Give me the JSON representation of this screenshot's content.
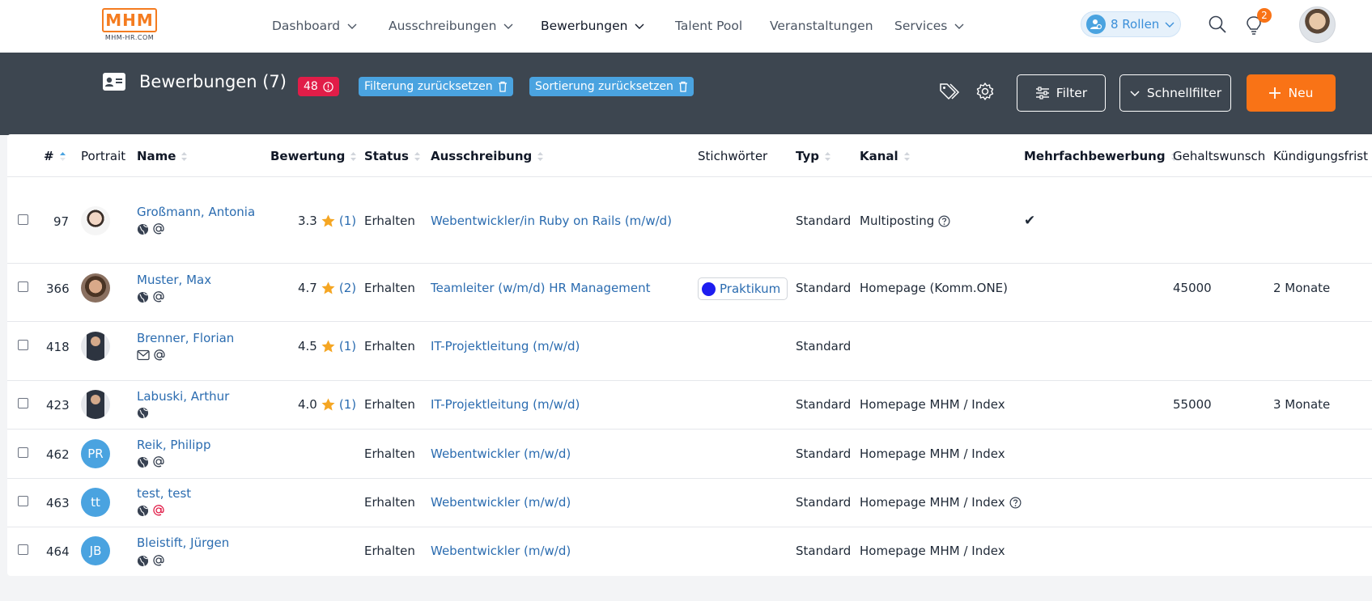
{
  "logo": {
    "mark": "MHM",
    "sub": "MHM-HR.COM"
  },
  "nav": {
    "items": [
      {
        "label": "Dashboard",
        "dropdown": true
      },
      {
        "label": "Ausschreibungen",
        "dropdown": true
      },
      {
        "label": "Bewerbungen",
        "dropdown": true,
        "active": true
      },
      {
        "label": "Talent Pool",
        "dropdown": false
      },
      {
        "label": "Veranstaltungen",
        "dropdown": false
      },
      {
        "label": "Services",
        "dropdown": true
      }
    ],
    "roles_label": "8 Rollen",
    "notifications_count": "2"
  },
  "header": {
    "title": "Bewerbungen (7)",
    "count_badge": "48",
    "reset_filter_label": "Filterung zurücksetzen",
    "reset_sort_label": "Sortierung zurücksetzen",
    "filter_label": "Filter",
    "quickfilter_label": "Schnellfilter",
    "new_label": "Neu"
  },
  "table": {
    "columns": {
      "id": "#",
      "portrait": "Portrait",
      "name": "Name",
      "rating": "Bewertung",
      "status": "Status",
      "posting": "Ausschreibung",
      "keywords": "Stichwörter",
      "type": "Typ",
      "channel": "Kanal",
      "multi": "Mehrfachbewerbung",
      "salary": "Gehaltswunsch",
      "notice": "Kündigungsfrist"
    },
    "rows": [
      {
        "id": "97",
        "name": "Großmann, Antonia",
        "rating": "3.3",
        "rating_count": "(1)",
        "status": "Erhalten",
        "posting": "Webentwickler/in Ruby on Rails (m/w/d)",
        "keyword": "",
        "type": "Standard",
        "channel": "Multiposting",
        "channel_help": true,
        "multi": "✔",
        "salary": "",
        "notice": "",
        "portrait": "photo-female",
        "icons": [
          "globe-icon",
          "at-icon"
        ]
      },
      {
        "id": "366",
        "name": "Muster, Max",
        "rating": "4.7",
        "rating_count": "(2)",
        "status": "Erhalten",
        "posting": "Teamleiter (w/m/d) HR Management",
        "keyword": "Praktikum",
        "type": "Standard",
        "channel": "Homepage (Komm.ONE)",
        "channel_help": false,
        "multi": "",
        "salary": "45000",
        "notice": "2 Monate",
        "portrait": "photo-male",
        "icons": [
          "globe-icon",
          "at-icon"
        ]
      },
      {
        "id": "418",
        "name": "Brenner, Florian",
        "rating": "4.5",
        "rating_count": "(1)",
        "status": "Erhalten",
        "posting": "IT-Projektleitung (m/w/d)",
        "keyword": "",
        "type": "Standard",
        "channel": "",
        "channel_help": false,
        "multi": "",
        "salary": "",
        "notice": "",
        "portrait": "photo-suit",
        "icons": [
          "mail-icon",
          "at-icon"
        ]
      },
      {
        "id": "423",
        "name": "Labuski, Arthur",
        "rating": "4.0",
        "rating_count": "(1)",
        "status": "Erhalten",
        "posting": "IT-Projektleitung (m/w/d)",
        "keyword": "",
        "type": "Standard",
        "channel": "Homepage MHM / Index",
        "channel_help": false,
        "multi": "",
        "salary": "55000",
        "notice": "3 Monate",
        "portrait": "photo-suit",
        "icons": [
          "globe-icon"
        ]
      },
      {
        "id": "462",
        "name": "Reik, Philipp",
        "rating": "",
        "rating_count": "",
        "status": "Erhalten",
        "posting": "Webentwickler (m/w/d)",
        "keyword": "",
        "type": "Standard",
        "channel": "Homepage MHM / Index",
        "channel_help": false,
        "multi": "",
        "salary": "",
        "notice": "",
        "initials": "PR",
        "icons": [
          "globe-icon",
          "at-icon"
        ]
      },
      {
        "id": "463",
        "name": "test, test",
        "rating": "",
        "rating_count": "",
        "status": "Erhalten",
        "posting": "Webentwickler (m/w/d)",
        "keyword": "",
        "type": "Standard",
        "channel": "Homepage MHM / Index",
        "channel_help": true,
        "multi": "",
        "salary": "",
        "notice": "",
        "initials": "tt",
        "icons": [
          "globe-icon",
          "at-icon-red"
        ]
      },
      {
        "id": "464",
        "name": "Bleistift, Jürgen",
        "rating": "",
        "rating_count": "",
        "status": "Erhalten",
        "posting": "Webentwickler (m/w/d)",
        "keyword": "",
        "type": "Standard",
        "channel": "Homepage MHM / Index",
        "channel_help": false,
        "multi": "",
        "salary": "",
        "notice": "",
        "initials": "JB",
        "icons": [
          "globe-icon",
          "at-icon"
        ]
      }
    ]
  },
  "colors": {
    "accent": "#f97316",
    "band": "#3d4650",
    "link": "#2b6cb0",
    "info": "#4aa3e0",
    "danger": "#e11d48",
    "star": "#f5a623"
  }
}
